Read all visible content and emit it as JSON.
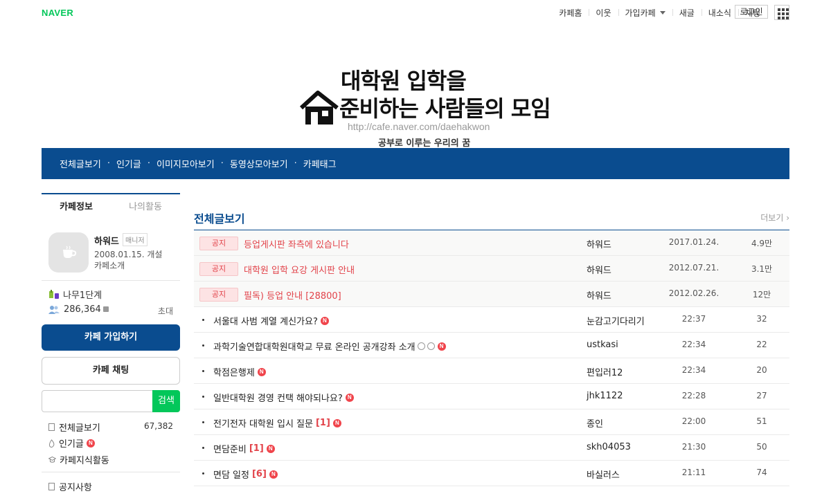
{
  "gnb": {
    "logo": "NAVER",
    "links": [
      "카페홈",
      "이웃",
      "가입카페",
      "새글",
      "내소식",
      "채팅"
    ],
    "login": "로그인"
  },
  "banner": {
    "line1": "대학원 입학을",
    "line2": "준비하는 사람들의 모임",
    "url": "http://cafe.naver.com/daehakwon",
    "slogan": "공부로 이루는 우리의 꿈"
  },
  "menubar": [
    "전체글보기",
    "인기글",
    "이미지모아보기",
    "동영상모아보기",
    "카페태그"
  ],
  "sidebar": {
    "tabs": [
      "카페정보",
      "나의활동"
    ],
    "manager_name": "하워드",
    "manager_badge": "매니저",
    "open_date": "2008.01.15. 개설",
    "intro": "카페소개",
    "level": "나무1단계",
    "members": "286,364",
    "invite": "초대",
    "join_label": "카페 가입하기",
    "chat_label": "카페 채팅",
    "search_label": "검색",
    "menu": [
      {
        "label": "전체글보기",
        "count": "67,382"
      },
      {
        "label": "인기글"
      },
      {
        "label": "카페지식활동"
      },
      {
        "label": "공지사항"
      }
    ]
  },
  "main": {
    "title": "전체글보기",
    "more": "더보기",
    "notice_badge": "공지",
    "notices": [
      {
        "title": "등업게시판 좌측에 있습니다",
        "author": "하워드",
        "date": "2017.01.24.",
        "views": "4.9만"
      },
      {
        "title": "대학원 입학 요강 게시판 안내",
        "author": "하워드",
        "date": "2012.07.21.",
        "views": "3.1만"
      },
      {
        "title": "필독) 등업 안내 [28800]",
        "author": "하워드",
        "date": "2012.02.26.",
        "views": "12만"
      }
    ],
    "posts": [
      {
        "title": "서울대 사범 계열 계신가요?",
        "comments": "",
        "author": "눈감고기다리기",
        "date": "22:37",
        "views": "32"
      },
      {
        "title": "과학기술연합대학원대학교 무료 온라인 공개강좌 소개",
        "comments": "",
        "author": "ustkasi",
        "date": "22:34",
        "views": "22"
      },
      {
        "title": "학점은행제",
        "comments": "",
        "author": "편입러12",
        "date": "22:34",
        "views": "20"
      },
      {
        "title": "일반대학원 경영 컨택 해야되나요?",
        "comments": "",
        "author": "jhk1122",
        "date": "22:28",
        "views": "27"
      },
      {
        "title": "전기전자 대학원 입시 질문",
        "comments": "[1]",
        "author": "종인",
        "date": "22:00",
        "views": "51"
      },
      {
        "title": "면담준비",
        "comments": "[1]",
        "author": "skh04053",
        "date": "21:30",
        "views": "50"
      },
      {
        "title": "면담 일정",
        "comments": "[6]",
        "author": "바실러스",
        "date": "21:11",
        "views": "74"
      }
    ]
  },
  "colors": {
    "brand": "#0a4c8f",
    "naver_green": "#03c75a",
    "notice_red": "#e2434a"
  }
}
